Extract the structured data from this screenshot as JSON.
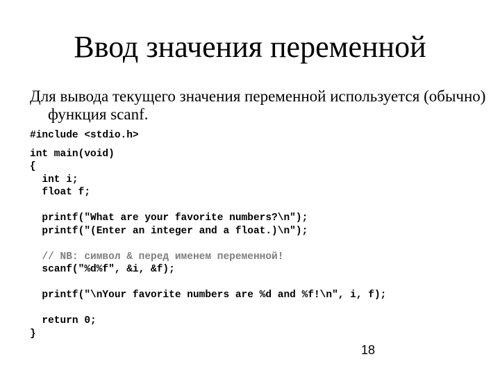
{
  "slide": {
    "title": "Ввод значения переменной",
    "bullet": "Для вывода текущего значения переменной используется (обычно) функция scanf.",
    "code_lines": [
      "#include <stdio.h>",
      "",
      "int main(void)",
      "{",
      "  int i;",
      "  float f;",
      "",
      "  printf(\"What are your favorite numbers?\\n\");",
      "  printf(\"(Enter an integer and a float.)\\n\");",
      "",
      "  // NB: символ & перед именем переменной!",
      "  scanf(\"%d%f\", &i, &f);",
      "",
      "  printf(\"\\nYour favorite numbers are %d and %f!\\n\", i, f);",
      "",
      "  return 0;",
      "}"
    ],
    "page_number": "18",
    "colors": {
      "text": "#000000",
      "comment": "#7f7f7f",
      "background": "#ffffff"
    }
  }
}
